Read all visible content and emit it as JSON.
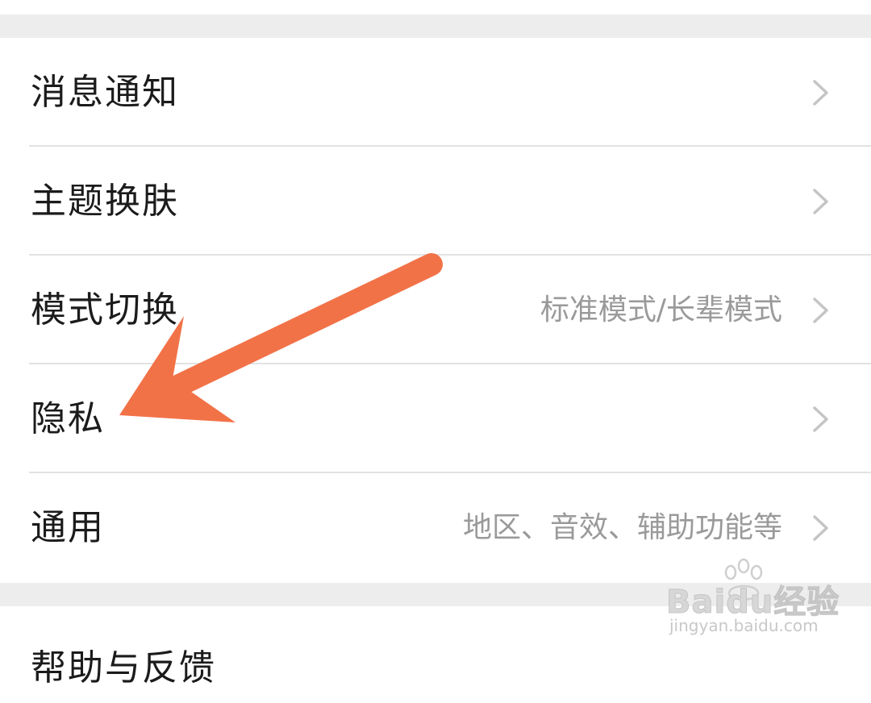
{
  "settings": {
    "items": [
      {
        "label": "消息通知",
        "value": ""
      },
      {
        "label": "主题换肤",
        "value": ""
      },
      {
        "label": "模式切换",
        "value": "标准模式/长辈模式"
      },
      {
        "label": "隐私",
        "value": ""
      },
      {
        "label": "通用",
        "value": "地区、音效、辅助功能等"
      }
    ],
    "help_label": "帮助与反馈"
  },
  "annotation": {
    "arrow_color": "#f27248",
    "target": "隐私"
  },
  "watermark": {
    "brand": "Baidu经验",
    "url": "jingyan.baidu.com"
  },
  "colors": {
    "background": "#ededed",
    "row": "#ffffff",
    "chevron": "#c5c5c5",
    "value_text": "#9a9a9a"
  }
}
